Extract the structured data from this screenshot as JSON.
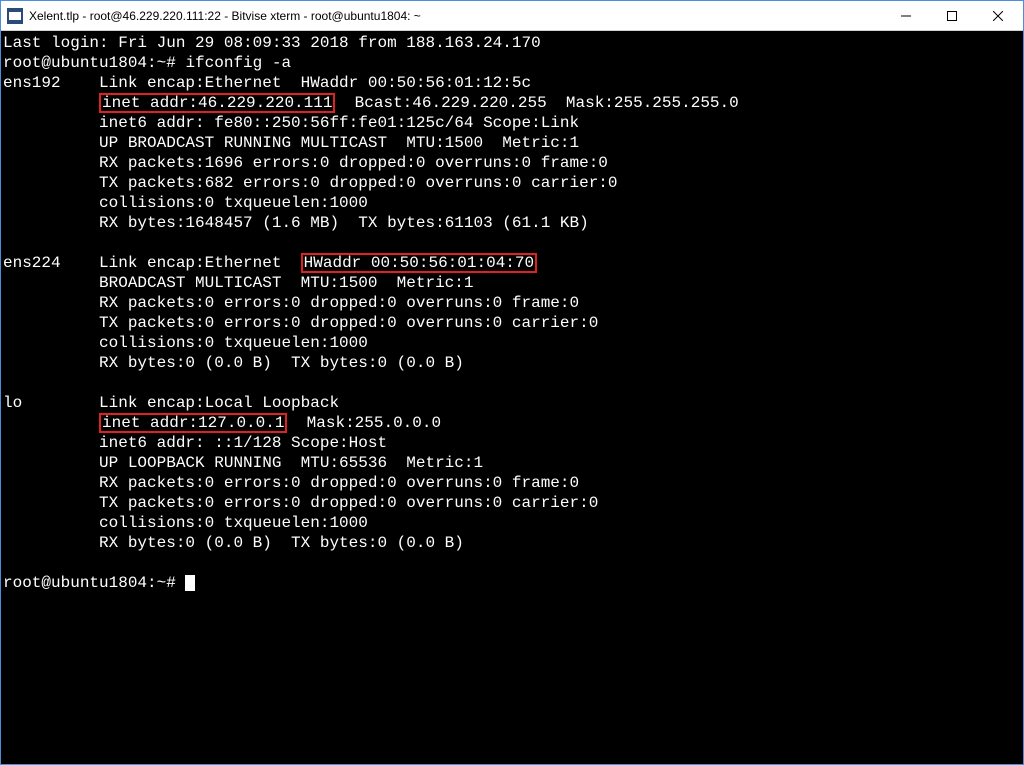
{
  "window": {
    "title": "Xelent.tlp - root@46.229.220.111:22 - Bitvise xterm - root@ubuntu1804: ~"
  },
  "term": {
    "last_login": "Last login: Fri Jun 29 08:09:33 2018 from 188.163.24.170",
    "prompt1": "root@ubuntu1804:~# ",
    "cmd1": "ifconfig -a",
    "prompt2": "root@ubuntu1804:~# ",
    "if1": {
      "name": "ens192",
      "l1a": "Link encap:Ethernet  HWaddr 00:50:56:01:12:5c",
      "hl1": "inet addr:46.229.220.111",
      "l2b": "  Bcast:46.229.220.255  Mask:255.255.255.0",
      "l3": "inet6 addr: fe80::250:56ff:fe01:125c/64 Scope:Link",
      "l4": "UP BROADCAST RUNNING MULTICAST  MTU:1500  Metric:1",
      "l5": "RX packets:1696 errors:0 dropped:0 overruns:0 frame:0",
      "l6": "TX packets:682 errors:0 dropped:0 overruns:0 carrier:0",
      "l7": "collisions:0 txqueuelen:1000",
      "l8": "RX bytes:1648457 (1.6 MB)  TX bytes:61103 (61.1 KB)"
    },
    "if2": {
      "name": "ens224",
      "l1a": "Link encap:Ethernet  ",
      "hl1": "HWaddr 00:50:56:01:04:70",
      "l2": "BROADCAST MULTICAST  MTU:1500  Metric:1",
      "l3": "RX packets:0 errors:0 dropped:0 overruns:0 frame:0",
      "l4": "TX packets:0 errors:0 dropped:0 overruns:0 carrier:0",
      "l5": "collisions:0 txqueuelen:1000",
      "l6": "RX bytes:0 (0.0 B)  TX bytes:0 (0.0 B)"
    },
    "if3": {
      "name": "lo",
      "l1a": "Link encap:Local Loopback",
      "hl1": "inet addr:127.0.0.1",
      "l2b": "  Mask:255.0.0.0",
      "l3": "inet6 addr: ::1/128 Scope:Host",
      "l4": "UP LOOPBACK RUNNING  MTU:65536  Metric:1",
      "l5": "RX packets:0 errors:0 dropped:0 overruns:0 frame:0",
      "l6": "TX packets:0 errors:0 dropped:0 overruns:0 carrier:0",
      "l7": "collisions:0 txqueuelen:1000",
      "l8": "RX bytes:0 (0.0 B)  TX bytes:0 (0.0 B)"
    }
  }
}
